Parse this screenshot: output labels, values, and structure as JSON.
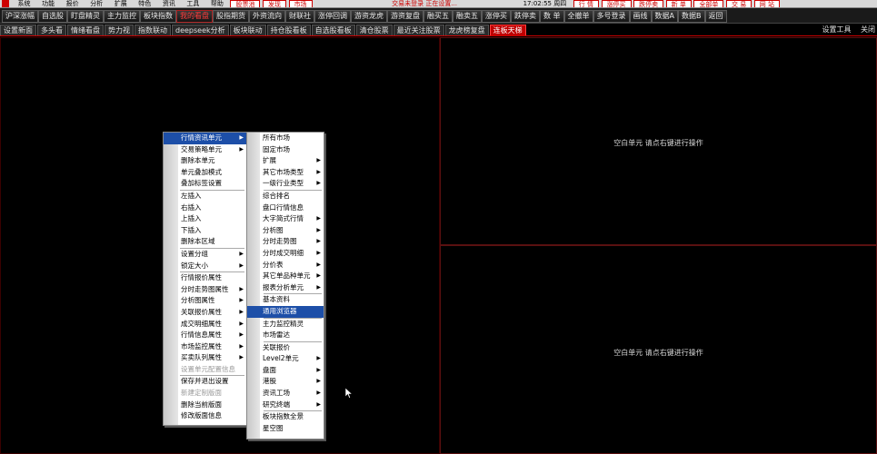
{
  "menubar": {
    "items": [
      "系统",
      "功能",
      "报价",
      "分析",
      "扩展",
      "特色",
      "资讯",
      "工具",
      "帮助"
    ],
    "pills": [
      "股票池",
      "发现",
      "市场"
    ],
    "status": "交易未登录  正在设置...",
    "clock": "17:02:55 周四",
    "right_pills": [
      "行 情",
      "涨停买",
      "跌停卖",
      "新 单",
      "全部单",
      "交 易",
      "网 站"
    ]
  },
  "toolbar": {
    "buttons": [
      "沪深涨幅",
      "自选股",
      "盯盘精灵",
      "主力监控",
      "板块指数",
      "我的看盘",
      "股指期货",
      "外资流向",
      "财联社",
      "涨停回调",
      "游资龙虎",
      "游资复盘",
      "融买五",
      "融卖五",
      "涨停买",
      "跌停卖",
      "数 单",
      "全撤单",
      "多号登录",
      "画线",
      "数据A",
      "数据B",
      "返回"
    ],
    "active_index": 5
  },
  "tabs": {
    "items": [
      "设置新面",
      "多头看",
      "情绪看盘",
      "势力视",
      "指数联动",
      "deepseek分析",
      "板块联动",
      "持仓股看板",
      "自选股看板",
      "清仓股票",
      "最近关注股票",
      "龙虎榜复盘",
      "连板天梯"
    ],
    "active_index": 12,
    "right": [
      "设置工具",
      "关闭"
    ]
  },
  "panes": {
    "right_top_hint": "空白单元 请点右键进行操作",
    "right_bottom_hint": "空白单元 请点右键进行操作"
  },
  "menu1": {
    "items": [
      {
        "label": "行情资讯单元",
        "arrow": true,
        "highlight": true
      },
      {
        "label": "交易策略单元",
        "arrow": true
      },
      {
        "label": "删除本单元"
      },
      {
        "label": "单元叠加模式"
      },
      {
        "label": "叠加标签设置"
      },
      {
        "sep": true
      },
      {
        "label": "左插入"
      },
      {
        "label": "右插入"
      },
      {
        "label": "上插入"
      },
      {
        "label": "下插入"
      },
      {
        "label": "删除本区域"
      },
      {
        "sep": true
      },
      {
        "label": "设置分组",
        "arrow": true
      },
      {
        "label": "锁定大小",
        "arrow": true
      },
      {
        "sep": true
      },
      {
        "label": "行情报价属性"
      },
      {
        "label": "分时走势图属性",
        "arrow": true
      },
      {
        "label": "分析图属性",
        "arrow": true
      },
      {
        "label": "关联报价属性",
        "arrow": true
      },
      {
        "label": "成交明细属性",
        "arrow": true
      },
      {
        "label": "行情信息属性",
        "arrow": true
      },
      {
        "label": "市场监控属性",
        "arrow": true
      },
      {
        "label": "买卖队列属性",
        "arrow": true
      },
      {
        "label": "设置单元配置信息",
        "disabled": true
      },
      {
        "sep": true
      },
      {
        "label": "保存并退出设置"
      },
      {
        "label": "新建定制版面",
        "disabled": true
      },
      {
        "label": "删除当前版面"
      },
      {
        "label": "修改版面信息"
      }
    ]
  },
  "menu2": {
    "items": [
      {
        "label": "所有市场"
      },
      {
        "label": "固定市场"
      },
      {
        "label": "扩展",
        "arrow": true
      },
      {
        "label": "其它市场类型",
        "arrow": true
      },
      {
        "label": "一级行业类型",
        "arrow": true
      },
      {
        "sep": true
      },
      {
        "label": "综合排名"
      },
      {
        "label": "盘口行情信息"
      },
      {
        "label": "大字简式行情",
        "arrow": true
      },
      {
        "label": "分析图",
        "arrow": true
      },
      {
        "label": "分时走势图",
        "arrow": true
      },
      {
        "label": "分时成交明细",
        "arrow": true
      },
      {
        "label": "分价表",
        "arrow": true
      },
      {
        "label": "其它单品种单元",
        "arrow": true
      },
      {
        "label": "报表分析单元",
        "arrow": true
      },
      {
        "sep": true
      },
      {
        "label": "基本资料"
      },
      {
        "label": "通用浏览器",
        "highlight": true
      },
      {
        "sep": true
      },
      {
        "label": "主力监控精灵"
      },
      {
        "label": "市场雷达"
      },
      {
        "sep": true
      },
      {
        "label": "关联报价"
      },
      {
        "label": "Level2单元",
        "arrow": true
      },
      {
        "label": "盘面",
        "arrow": true
      },
      {
        "label": "港股",
        "arrow": true
      },
      {
        "label": "资讯工场",
        "arrow": true
      },
      {
        "label": "研究终端",
        "arrow": true
      },
      {
        "sep": true
      },
      {
        "label": "板块指数全景"
      },
      {
        "label": "星空图"
      }
    ]
  }
}
